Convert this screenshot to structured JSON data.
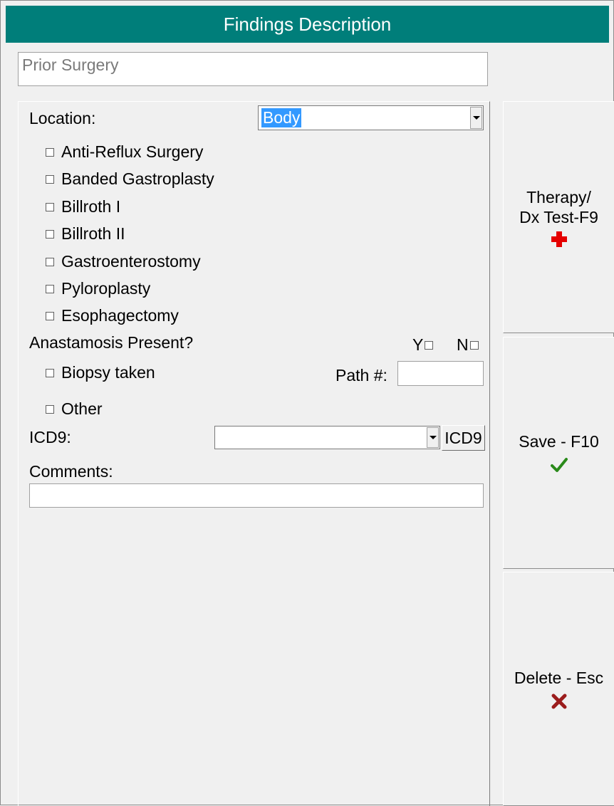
{
  "window": {
    "title": "Findings Description"
  },
  "finding_name": "Prior Surgery",
  "form": {
    "location": {
      "label": "Location:",
      "value": "Body"
    },
    "procedures": [
      {
        "label": "Anti-Reflux Surgery",
        "checked": false
      },
      {
        "label": "Banded Gastroplasty",
        "checked": false
      },
      {
        "label": "Billroth I",
        "checked": false
      },
      {
        "label": "Billroth II",
        "checked": false
      },
      {
        "label": "Gastroenterostomy",
        "checked": false
      },
      {
        "label": "Pyloroplasty",
        "checked": false
      },
      {
        "label": "Esophagectomy",
        "checked": false
      }
    ],
    "anastomosis": {
      "label": "Anastamosis Present?",
      "yes_label": "Y",
      "no_label": "N"
    },
    "biopsy": {
      "label": "Biopsy taken",
      "path_label": "Path #:",
      "path_value": ""
    },
    "other": {
      "label": "Other"
    },
    "icd9": {
      "label": "ICD9:",
      "value": "",
      "button_label": "ICD9"
    },
    "comments": {
      "label": "Comments:",
      "value": ""
    }
  },
  "side_buttons": {
    "therapy": {
      "line1": "Therapy/",
      "line2": "Dx Test-F9",
      "icon": "plus-icon",
      "color": "#e50000"
    },
    "save": {
      "label": "Save - F10",
      "icon": "check-icon",
      "color": "#2a8a1a"
    },
    "delete": {
      "label": "Delete - Esc",
      "icon": "x-icon",
      "color": "#9b1c1c"
    }
  },
  "colors": {
    "title_bar": "#007e7a",
    "selection": "#3399ff"
  }
}
